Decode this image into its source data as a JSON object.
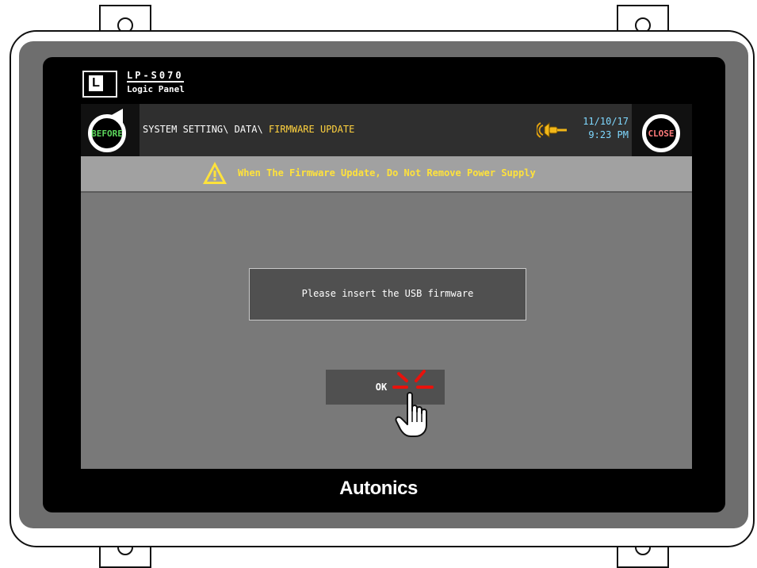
{
  "device": {
    "model": "LP-S070",
    "model_sub": "Logic Panel",
    "brand": "Autonics",
    "logo_letter": "L"
  },
  "header": {
    "before_label": "BEFORE",
    "close_label": "CLOSE",
    "path_prefix": "SYSTEM SETTING\\ DATA\\ ",
    "path_current": "FIRMWARE UPDATE",
    "date": "11/10/17",
    "time": "9:23 PM"
  },
  "warning": {
    "text": "When The Firmware Update, Do Not Remove Power Supply"
  },
  "dialog": {
    "message": "Please insert the USB firmware",
    "ok_label": "OK"
  },
  "icons": {
    "before": "undo-arrow-icon",
    "sound": "speaker-icon",
    "warning": "warning-triangle-icon",
    "pointer": "hand-pointer-icon",
    "tap": "tap-spark-icon"
  },
  "colors": {
    "path_highlight": "#ffd23f",
    "warning_text": "#ffe23b",
    "before_text": "#5cd65c",
    "close_text": "#ff7b7b",
    "datetime_text": "#7fd8ff",
    "screen_bg": "#797979"
  }
}
